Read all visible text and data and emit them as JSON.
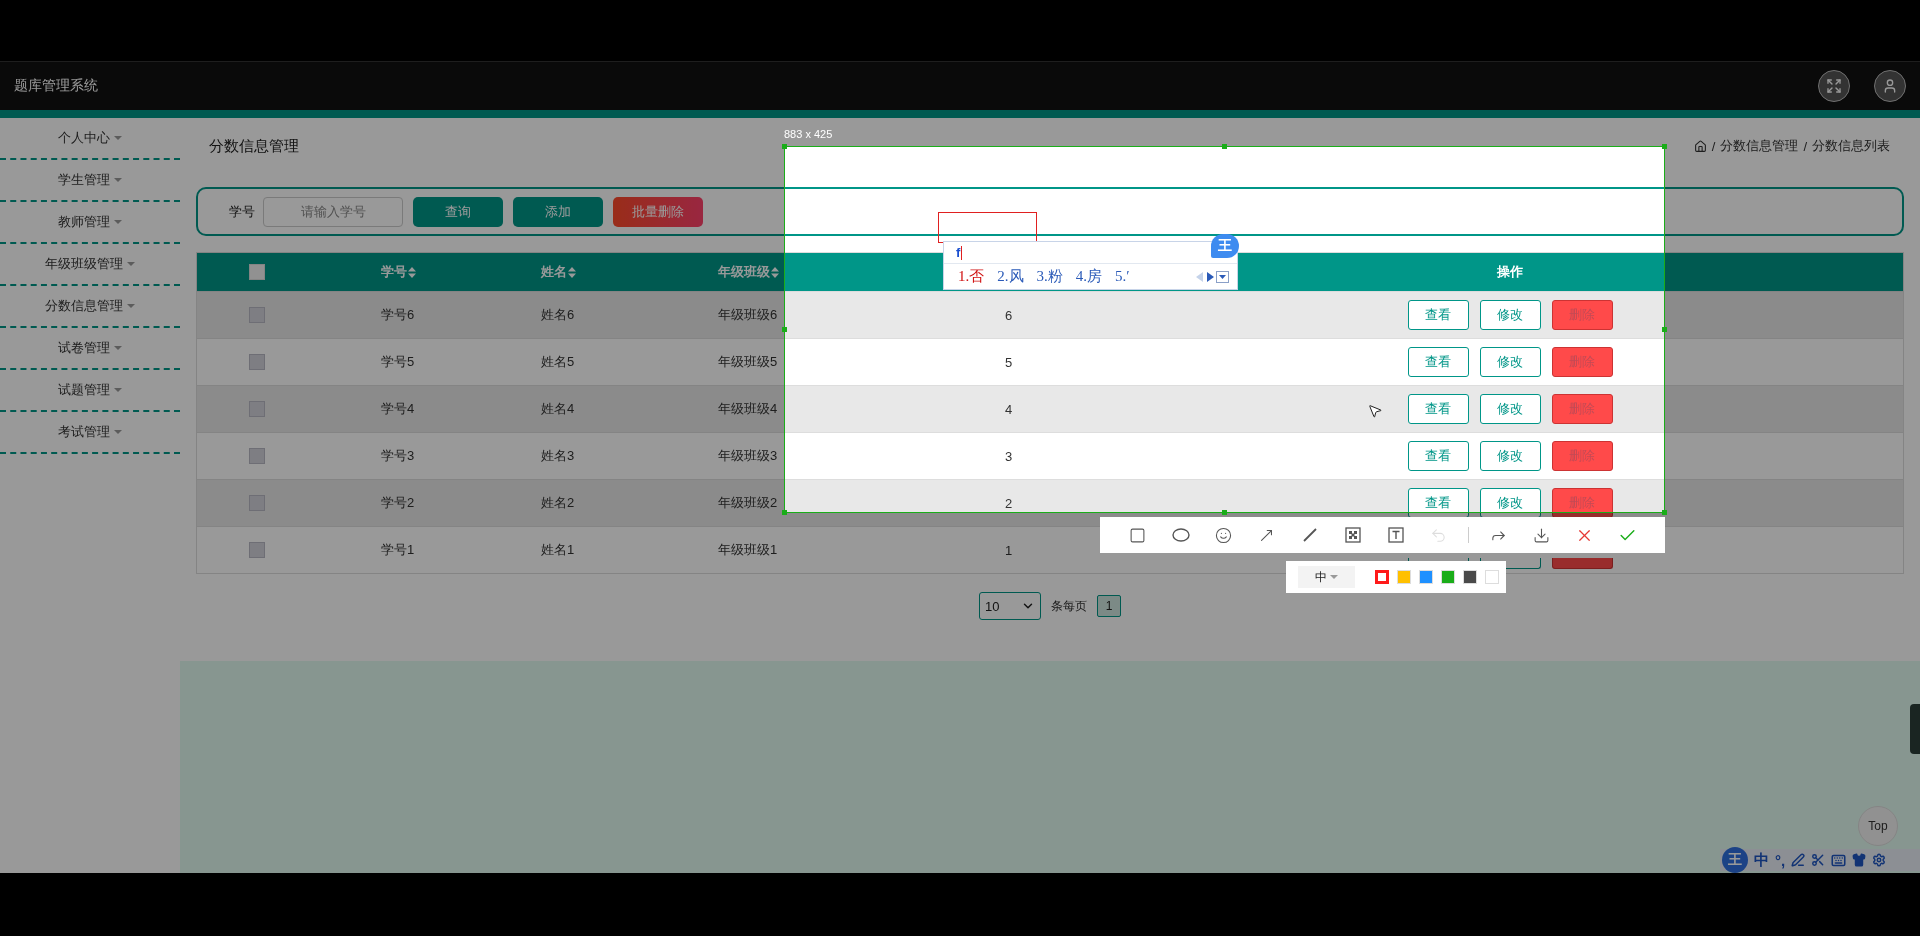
{
  "app_header": {
    "title": "题库管理系统"
  },
  "sidebar": {
    "items": [
      {
        "label": "个人中心"
      },
      {
        "label": "学生管理"
      },
      {
        "label": "教师管理"
      },
      {
        "label": "年级班级管理"
      },
      {
        "label": "分数信息管理"
      },
      {
        "label": "试卷管理"
      },
      {
        "label": "试题管理"
      },
      {
        "label": "考试管理"
      }
    ]
  },
  "page": {
    "title": "分数信息管理",
    "breadcrumb_separator": "/",
    "breadcrumb": [
      "分数信息管理",
      "分数信息列表"
    ]
  },
  "search": {
    "label": "学号",
    "placeholder": "请输入学号",
    "buttons": [
      {
        "label": "查询",
        "kind": "primary"
      },
      {
        "label": "添加",
        "kind": "primary"
      },
      {
        "label": "批量删除",
        "kind": "danger"
      }
    ]
  },
  "table": {
    "select_all_checked": false,
    "columns": [
      {
        "kind": "sortable",
        "label": "学号"
      },
      {
        "kind": "sortable",
        "label": "姓名"
      },
      {
        "kind": "sortable",
        "label": "年级班级"
      },
      {
        "kind": "covered"
      },
      {
        "kind": "actions",
        "label": "操作"
      }
    ],
    "rows": [
      {
        "checked": false,
        "cells": [
          "学号6",
          "姓名6",
          "年级班级6",
          "6"
        ],
        "actions": [
          {
            "label": "查看",
            "kind": "view"
          },
          {
            "label": "修改",
            "kind": "edit"
          },
          {
            "label": "删除",
            "kind": "delete"
          }
        ]
      },
      {
        "checked": false,
        "cells": [
          "学号5",
          "姓名5",
          "年级班级5",
          "5"
        ],
        "actions": [
          {
            "label": "查看",
            "kind": "view"
          },
          {
            "label": "修改",
            "kind": "edit"
          },
          {
            "label": "删除",
            "kind": "delete"
          }
        ]
      },
      {
        "checked": false,
        "cells": [
          "学号4",
          "姓名4",
          "年级班级4",
          "4"
        ],
        "actions": [
          {
            "label": "查看",
            "kind": "view"
          },
          {
            "label": "修改",
            "kind": "edit"
          },
          {
            "label": "删除",
            "kind": "delete"
          }
        ]
      },
      {
        "checked": false,
        "cells": [
          "学号3",
          "姓名3",
          "年级班级3",
          "3"
        ],
        "actions": [
          {
            "label": "查看",
            "kind": "view"
          },
          {
            "label": "修改",
            "kind": "edit"
          },
          {
            "label": "删除",
            "kind": "delete"
          }
        ]
      },
      {
        "checked": false,
        "cells": [
          "学号2",
          "姓名2",
          "年级班级2",
          "2"
        ],
        "actions": [
          {
            "label": "查看",
            "kind": "view"
          },
          {
            "label": "修改",
            "kind": "edit"
          },
          {
            "label": "删除",
            "kind": "delete"
          }
        ]
      },
      {
        "checked": false,
        "cells": [
          "学号1",
          "姓名1",
          "年级班级1",
          "1"
        ],
        "actions": [
          {
            "kind": "view"
          },
          {
            "kind": "edit"
          },
          {
            "kind": "delete"
          }
        ]
      }
    ]
  },
  "pagination": {
    "page_size": "10",
    "page_size_label": "条每页",
    "pages": [
      {
        "label": "1",
        "selected": true
      }
    ]
  },
  "screenshot_tool": {
    "size_label": "883 x 425",
    "tools": [
      {
        "kind": "rectangle",
        "disabled": false
      },
      {
        "kind": "ellipse",
        "disabled": false
      },
      {
        "kind": "emoji",
        "disabled": false
      },
      {
        "kind": "arrow",
        "disabled": false
      },
      {
        "kind": "line",
        "disabled": false
      },
      {
        "kind": "mosaic",
        "disabled": false
      },
      {
        "kind": "text",
        "disabled": false
      },
      {
        "kind": "undo",
        "disabled": true
      }
    ],
    "actions": [
      {
        "kind": "share"
      },
      {
        "kind": "save"
      },
      {
        "kind": "cancel"
      },
      {
        "kind": "confirm"
      }
    ],
    "pen_size": "中",
    "colors": [
      {
        "color": "#ff1a1a",
        "selected": true
      },
      {
        "color": "#ffc000",
        "selected": false
      },
      {
        "color": "#1e90ff",
        "selected": false
      },
      {
        "color": "#1aad19",
        "selected": false
      },
      {
        "color": "#4a4a4a",
        "selected": false
      },
      {
        "color": "#ffffff",
        "selected": false
      }
    ]
  },
  "ime_popup": {
    "logo": "王",
    "input": "f",
    "candidates": [
      {
        "label": "1.否",
        "selected": true
      },
      {
        "label": "2.风",
        "selected": false
      },
      {
        "label": "3.粉",
        "selected": false
      },
      {
        "label": "4.房",
        "selected": false
      },
      {
        "label": "5.′",
        "selected": false
      }
    ]
  },
  "ime_status_bar": {
    "logo": "王",
    "mode": "中",
    "punctuation": "°,"
  },
  "back_to_top": {
    "label": "Top"
  }
}
